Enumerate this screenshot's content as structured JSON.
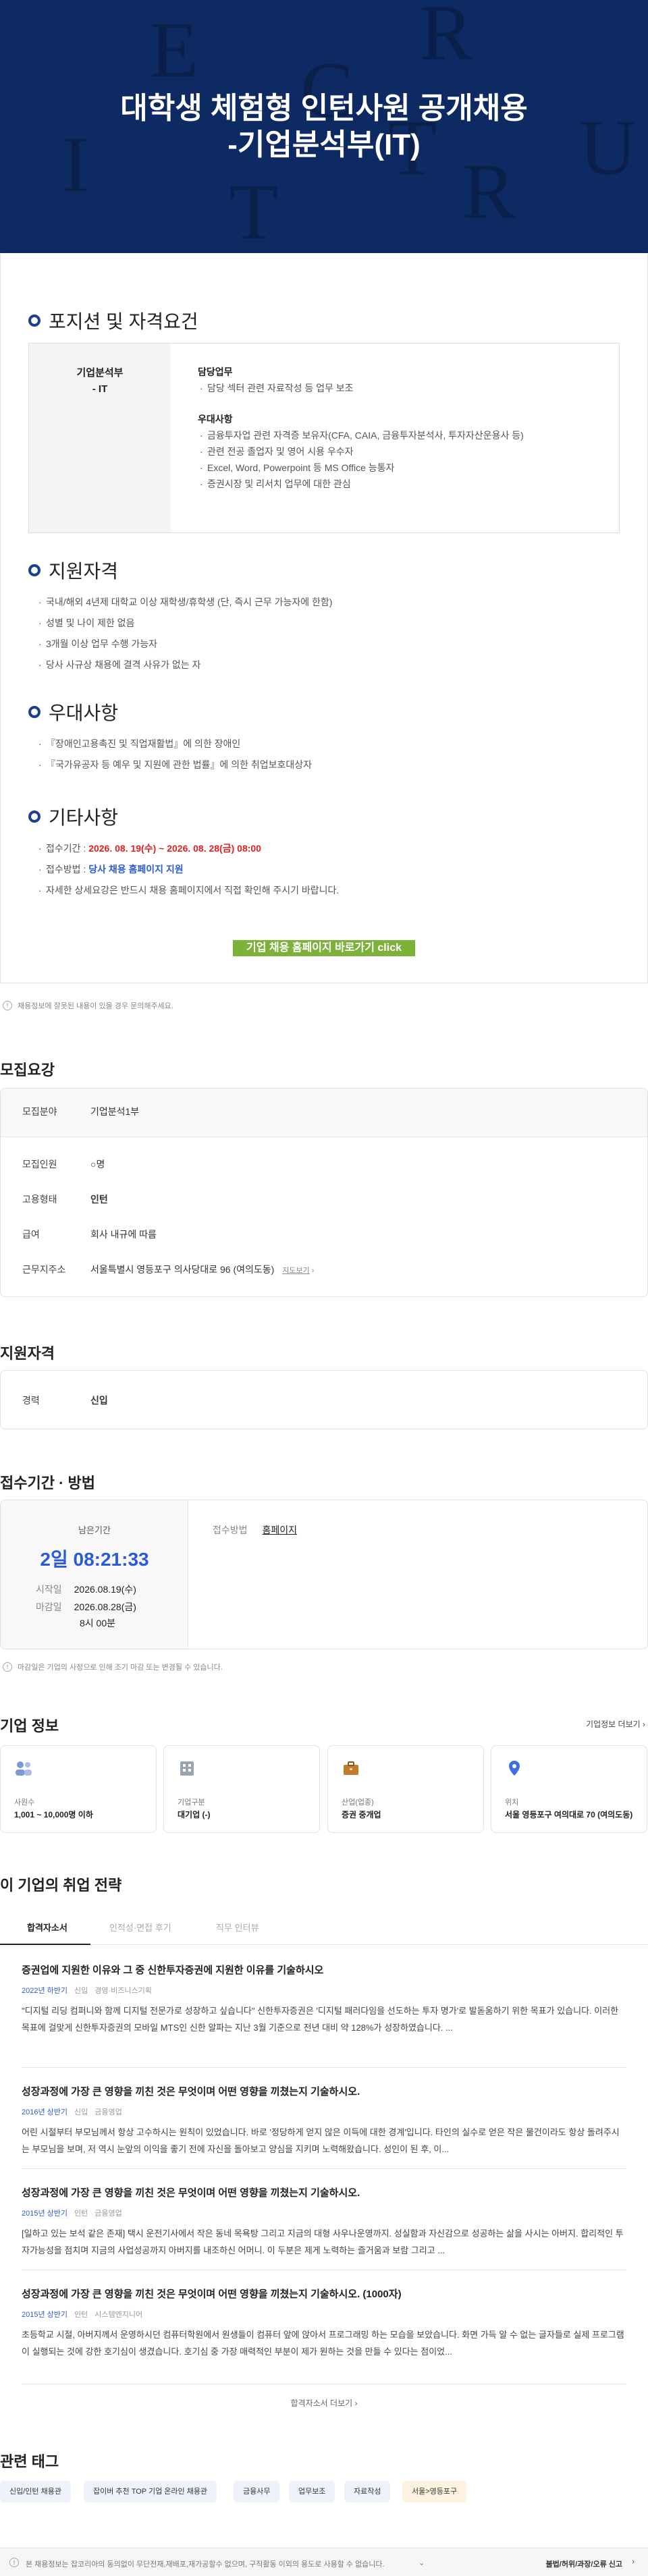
{
  "hero": {
    "title1": "대학생 체험형 인턴사원 공개채용",
    "title2": "-기업분석부(IT)",
    "letters": [
      "E",
      "R",
      "C",
      "I",
      "U",
      "R",
      "T",
      "T"
    ]
  },
  "position": {
    "heading": "포지션 및 자격요건",
    "dept": "기업분석부",
    "dept_sub": "- IT",
    "duty_title": "담당업무",
    "duties": [
      "담당 섹터 관련 자료작성 등 업무 보조"
    ],
    "pref_title": "우대사항",
    "prefs": [
      "금융투자업 관련 자격증 보유자(CFA, CAIA, 금융투자분석사, 투자자산운용사 등)",
      "관련 전공 졸업자 및 영어 시용 우수자",
      "Excel, Word, Powerpoint 등 MS Office 능통자",
      "증권시장 및 리서치 업무에 대한 관심"
    ]
  },
  "qual": {
    "heading": "지원자격",
    "items": [
      "국내/해외 4년제 대학교 이상 재학생/휴학생 (단, 즉시 근무 가능자에 한함)",
      "성별 및 나이 제한 없음",
      "3개월 이상 업무 수행 가능자",
      "당사 사규상 채용에 결격 사유가 없는 자"
    ]
  },
  "pref": {
    "heading": "우대사항",
    "items": [
      "『장애인고용촉진 및 직업재활법』에 의한 장애인",
      "『국가유공자 등 예우 및 지원에 관한 법률』에 의한 취업보호대상자"
    ]
  },
  "etc": {
    "heading": "기타사항",
    "period_label": "접수기간 : ",
    "period": "2026. 08. 19(수) ~ 2026. 08. 28(금) 08:00",
    "method_label": "접수방법 : ",
    "method": "당사 채용 홈페이지 지원",
    "info": "자세한 상세요강은 반드시 채용 홈페이지에서 직접 확인해 주시기 바랍니다."
  },
  "cta": {
    "label": "기업 채용 홈페이지 바로가기 click"
  },
  "notice": {
    "text": "채용정보에 잘못된 내용이 있을 경우 문의해주세요."
  },
  "summary": {
    "heading": "모집요강",
    "rows": [
      {
        "k": "모집분야",
        "v": "기업분석1부"
      },
      {
        "k": "모집인원",
        "v": "○명"
      },
      {
        "k": "고용형태",
        "v": "인턴"
      },
      {
        "k": "급여",
        "v": "회사 내규에 따름"
      },
      {
        "k": "근무지주소",
        "v": "서울특별시 영등포구 의사당대로 96 (여의도동)"
      }
    ],
    "map_link": "지도보기"
  },
  "career": {
    "heading": "지원자격",
    "k": "경력",
    "v": "신입"
  },
  "period": {
    "heading": "접수기간 · 방법",
    "remaining_label": "남은기간",
    "remaining": "2일 08:21:33",
    "start_label": "시작일",
    "start": "2026.08.19(수)",
    "end_label": "마감일",
    "end": "2026.08.28(금)",
    "end_time": "8시 00분",
    "method_label": "접수방법",
    "method": "홈페이지",
    "note": "마감일은 기업의 사정으로 인해 조기 마감 또는 변경될 수 있습니다."
  },
  "company": {
    "heading": "기업 정보",
    "more": "기업정보 더보기",
    "cards": [
      {
        "label": "사원수",
        "value": "1,001 ~ 10,000명 이하"
      },
      {
        "label": "기업구분",
        "value": "대기업 (-)"
      },
      {
        "label": "산업(업종)",
        "value": "증권 중개업"
      },
      {
        "label": "위치",
        "value": "서울 영등포구 여의대로 70 (여의도동)"
      }
    ]
  },
  "strategy": {
    "heading": "이 기업의 취업 전략",
    "tabs": [
      "합격자소서",
      "인적성·면접 후기",
      "직무 인터뷰"
    ],
    "essays": [
      {
        "title": "증권업에 지원한 이유와 그 중 신한투자증권에 지원한 이유를 기술하시오",
        "year": "2022년 하반기",
        "type": "신입",
        "field": "경영·비즈니스기획",
        "content": "\"디지털 리딩 컴퍼니와 함께 디지털 전문가로 성장하고 싶습니다\" 신한투자증권은 '디지털 패러다임을 선도하는 투자 명가'로 발돋움하기 위한 목표가 있습니다. 이러한 목표에 걸맞게 신한투자증권의 모바일 MTS인 신한 알파는 지난 3월 기준으로 전년 대비 약 128%가 성장하였습니다. ..."
      },
      {
        "title": "성장과정에 가장 큰 영향을 끼친 것은 무엇이며 어떤 영향을 끼쳤는지 기술하시오.",
        "year": "2016년 상반기",
        "type": "신입",
        "field": "금융영업",
        "content": "어린 시절부터 부모님께서 항상 고수하시는 원칙이 있었습니다. 바로 '정당하게 얻지 않은 이득에 대한 경계'입니다. 타인의 실수로 얻은 작은 물건이라도 항상 돌려주시는 부모님을 보며, 저 역시 눈앞의 이익을 좋기 전에 자신을 돌아보고 양심을 지키며 노력해왔습니다. 성인이 된 후, 이..."
      },
      {
        "title": "성장과정에 가장 큰 영향을 끼친 것은 무엇이며 어떤 영향을 끼쳤는지 기술하시오.",
        "year": "2015년 상반기",
        "type": "인턴",
        "field": "금융영업",
        "content": "[일하고 있는 보석 같은 존재] 택시 운전기사에서 작은 동네 목욕탕 그리고 지금의 대형 사우나운영까지. 성실함과 자신감으로 성공하는 삶을 사시는 아버지. 합리적인 투자가능성을 점치며 지금의 사업성공까지 아버지를 내조하신 어머니. 이 두분은 제게 노력하는 즐거움과 보람 그리고 ..."
      },
      {
        "title": "성장과정에 가장 큰 영향을 끼친 것은 무엇이며 어떤 영향을 끼쳤는지 기술하시오. (1000자)",
        "year": "2015년 상반기",
        "type": "인턴",
        "field": "시스템엔지니어",
        "content": "초등학교 시절, 아버지께서 운영하시던 컴퓨터학원에서 원생들이 컴퓨터 앞에 앉아서 프로그래밍 하는 모습을 보았습니다. 화면 가득 알 수 없는 글자들로 실제 프로그램이 실행되는 것에 강한 호기심이 생겼습니다. 호기심 중 가장 매력적인 부분이 제가 원하는 것을 만들 수 있다는 점이었..."
      }
    ],
    "more": "합격자소서 더보기"
  },
  "tags": {
    "heading": "관련 태그",
    "items": [
      "신입/인턴 채용관",
      "잡이버 추천 TOP 기업 온라인 채용관",
      "금융사무",
      "업무보조",
      "자료작성",
      "서울>영등포구"
    ]
  },
  "footer": {
    "notice": "본 채용정보는 잡코리아의 동의없이 무단전재,재배포,재가공할수 없으며, 구직활동 이외의 용도로 사용할 수 없습니다.",
    "report": "불법/허위/과장/오류 신고"
  },
  "colors": {
    "hero_bg": "#0e2a63",
    "accent_blue": "#2a5bd7",
    "highlight_red": "#e02020",
    "cta_green": "#7db23a"
  }
}
